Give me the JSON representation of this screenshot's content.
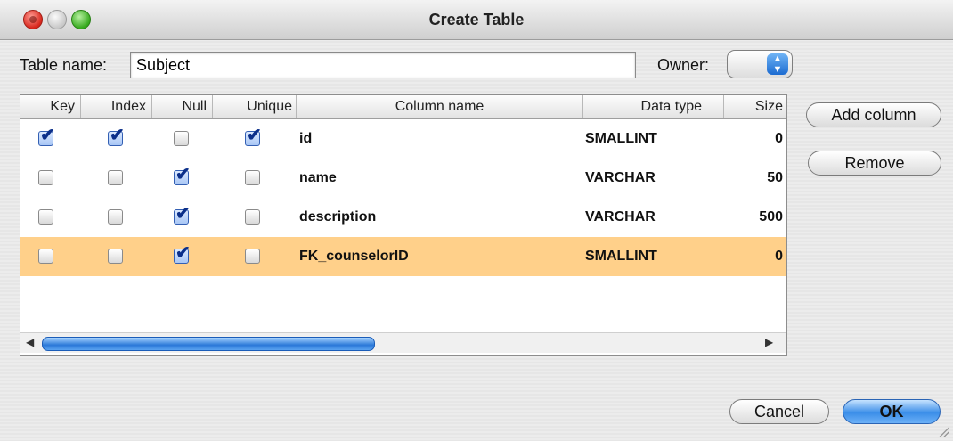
{
  "window": {
    "title": "Create Table"
  },
  "form": {
    "table_name_label": "Table name:",
    "table_name_value": "Subject",
    "owner_label": "Owner:",
    "owner_value": ""
  },
  "table": {
    "columns": [
      "Key",
      "Index",
      "Null",
      "Unique",
      "Column name",
      "Data type",
      "Size"
    ],
    "rows": [
      {
        "key": true,
        "index": true,
        "null": false,
        "unique": true,
        "column_name": "id",
        "data_type": "SMALLINT",
        "size": "0",
        "selected": false
      },
      {
        "key": false,
        "index": false,
        "null": true,
        "unique": false,
        "column_name": "name",
        "data_type": "VARCHAR",
        "size": "50",
        "selected": false
      },
      {
        "key": false,
        "index": false,
        "null": true,
        "unique": false,
        "column_name": "description",
        "data_type": "VARCHAR",
        "size": "500",
        "selected": false
      },
      {
        "key": false,
        "index": false,
        "null": true,
        "unique": false,
        "column_name": "FK_counselorID",
        "data_type": "SMALLINT",
        "size": "0",
        "selected": true
      }
    ]
  },
  "buttons": {
    "add_column": "Add column",
    "remove": "Remove",
    "cancel": "Cancel",
    "ok": "OK"
  },
  "colors": {
    "selected_row": "#ffd08a",
    "accent": "#3b8ee8"
  }
}
